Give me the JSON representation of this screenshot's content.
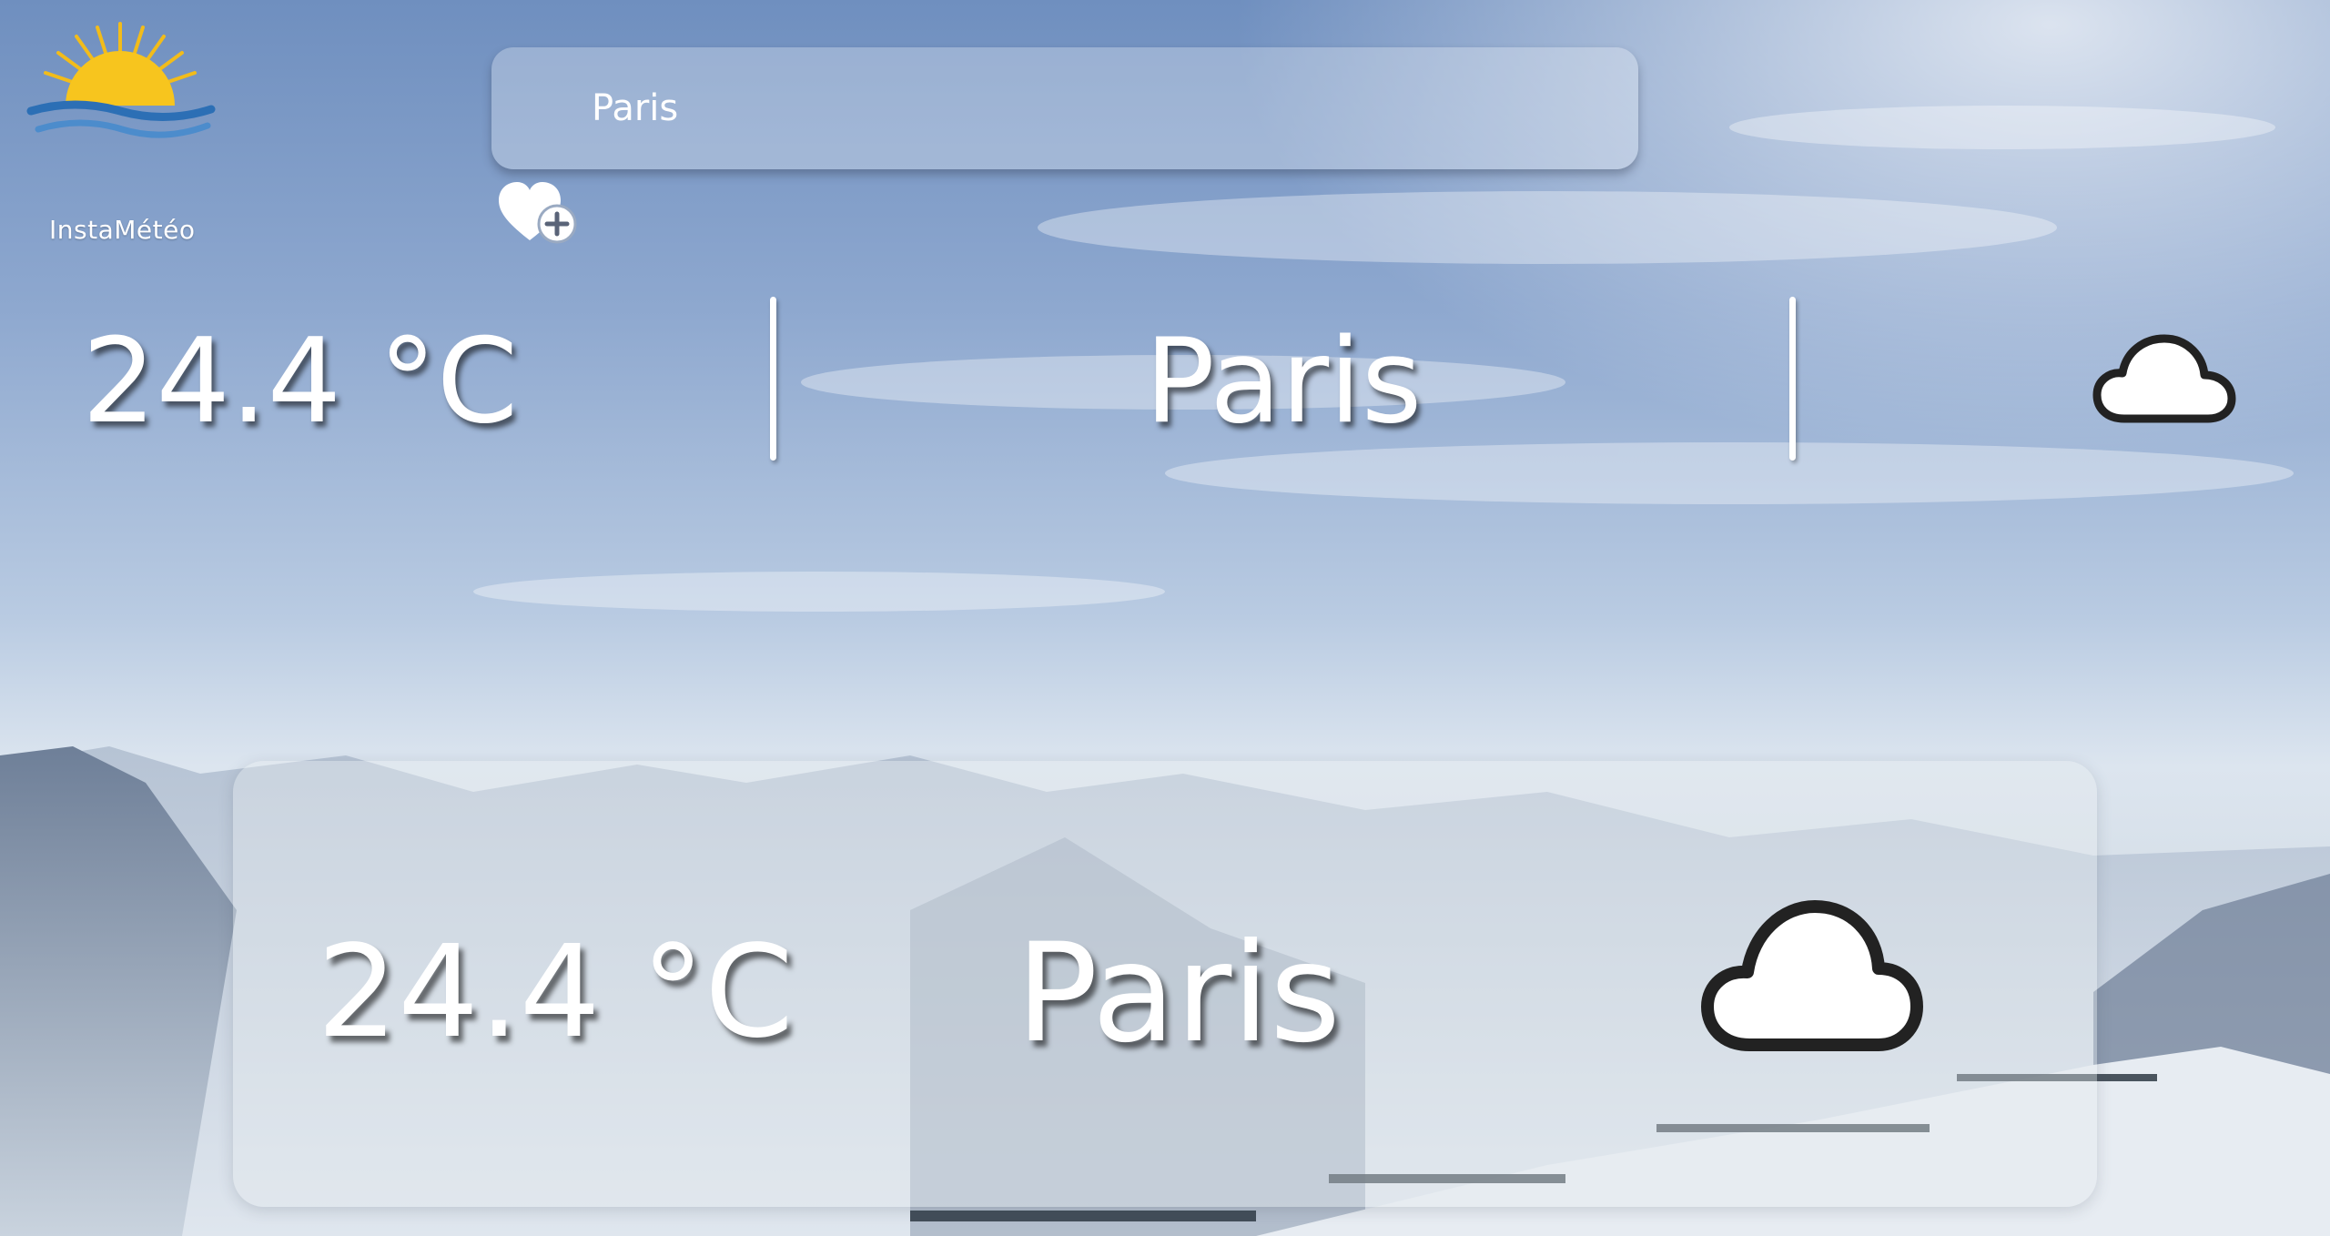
{
  "app": {
    "brand": "InstaMétéo",
    "logo_icon": "sunrise-over-waves-icon"
  },
  "search": {
    "value": "Paris",
    "placeholder": ""
  },
  "favorite": {
    "icon": "heart-plus-icon"
  },
  "current": {
    "temperature": "24.4 °C",
    "city": "Paris",
    "condition_icon": "cloud-icon"
  },
  "card": {
    "temperature": "24.4 °C",
    "city": "Paris",
    "condition_icon": "cloud-icon"
  },
  "colors": {
    "text": "#ffffff",
    "icon_stroke": "#222222",
    "sun": "#f5c21b",
    "wave_blue": "#2c6fb5"
  }
}
